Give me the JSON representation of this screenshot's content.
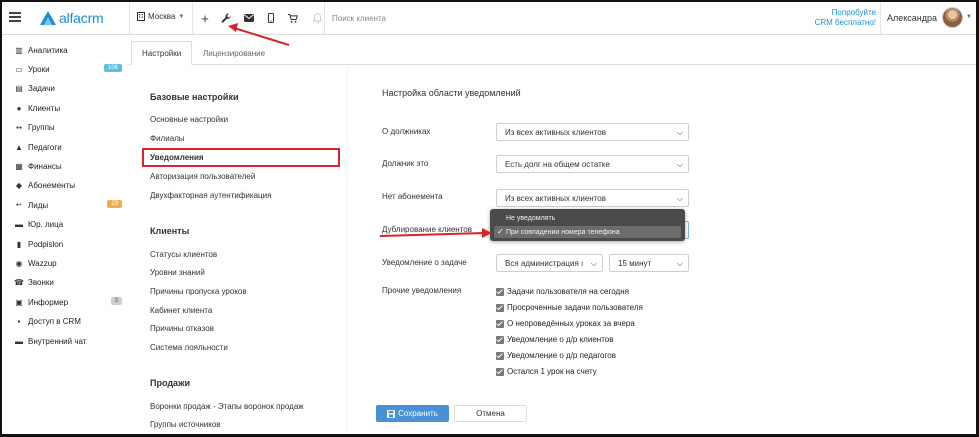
{
  "header": {
    "logo_text": "alfacrm",
    "city": "Москва",
    "search_placeholder": "Поиск клиента",
    "promo": [
      "Попробуйте",
      "CRM бесплатно!"
    ],
    "user_name": "Александра"
  },
  "sidebar": {
    "items": [
      {
        "label": "Аналитика",
        "icon": "chart-icon"
      },
      {
        "label": "Уроки",
        "icon": "calendar-icon",
        "badge": "106"
      },
      {
        "label": "Задачи",
        "icon": "task-icon"
      },
      {
        "label": "Клиенты",
        "icon": "user-icon"
      },
      {
        "label": "Группы",
        "icon": "group-icon"
      },
      {
        "label": "Педагоги",
        "icon": "graduation-icon"
      },
      {
        "label": "Финансы",
        "icon": "money-icon"
      },
      {
        "label": "Абонементы",
        "icon": "tag-icon"
      },
      {
        "label": "Лиды",
        "icon": "user-plus-icon",
        "badge": "23"
      },
      {
        "label": "Юр. лица",
        "icon": "briefcase-icon"
      },
      {
        "label": "Podpislon",
        "icon": "document-icon"
      },
      {
        "label": "Wazzup",
        "icon": "whatsapp-icon"
      },
      {
        "label": "Звонки",
        "icon": "phone-icon"
      },
      {
        "label": "Информер",
        "icon": "informer-icon",
        "badge": "3"
      },
      {
        "label": "Доступ в CRM",
        "icon": "lock-icon"
      },
      {
        "label": "Внутренний чат",
        "icon": "chat-icon"
      }
    ]
  },
  "tabs": [
    {
      "label": "Настройки",
      "active": true
    },
    {
      "label": "Лицензирование",
      "active": false
    }
  ],
  "settings_menu": {
    "sections": [
      {
        "title": "Базовые настройки",
        "items": [
          "Основные настройки",
          "Филиалы",
          "Уведомления",
          "Авторизация пользователей",
          "Двухфакторная аутентификация"
        ]
      },
      {
        "title": "Клиенты",
        "items": [
          "Статусы клиентов",
          "Уровни знаний",
          "Причины пропуска уроков",
          "Кабинет клиента",
          "Причины отказов",
          "Система лояльности"
        ]
      },
      {
        "title": "Продажи",
        "items": [
          "Воронки продаж - Этапы воронок продаж",
          "Группы источников"
        ]
      }
    ]
  },
  "notifications": {
    "title": "Настройка области уведомлений",
    "fields": [
      {
        "label": "О должниках",
        "value": "Из всех активных клиентов"
      },
      {
        "label": "Должник это",
        "value": "Есть долг на общем остатке"
      },
      {
        "label": "Нет абонемента",
        "value": "Из всех активных клиентов"
      },
      {
        "label": "Дублирование клиентов",
        "value": "При совпадении номера телефона"
      }
    ],
    "duplicate_options": [
      "Не уведомлять",
      "При совпадении номера телефона"
    ],
    "task_label": "Уведомление о задаче",
    "task_value_1": "Вся администрация ı",
    "task_value_2": "15 минут",
    "other_label": "Прочие уведомления",
    "checkboxes": [
      "Задачи пользователя на сегодня",
      "Просроченные задачи пользователя",
      "О непроведённых уроках за вчера",
      "Уведомление о д/р клиентов",
      "Уведомление о д/р педагогов",
      "Остался 1 урок на счету"
    ],
    "save_label": "Сохранить",
    "cancel_label": "Отмена"
  },
  "colors": {
    "accent": "#1a8fd8",
    "badge_blue": "#5bc0de",
    "badge_orange": "#f0ad4e",
    "badge_gray": "#cfcfcf",
    "annotation_red": "#d9232d"
  }
}
